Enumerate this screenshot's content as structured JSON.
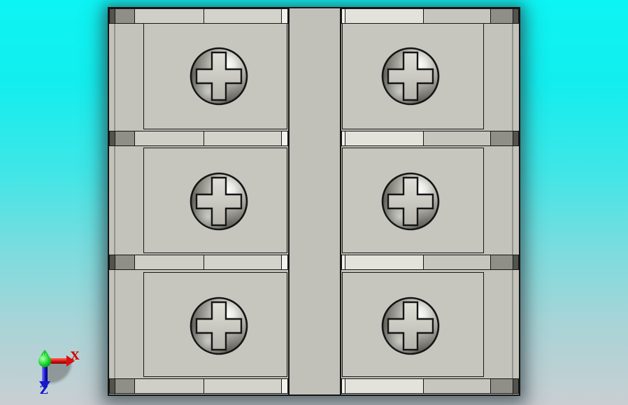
{
  "viewport": {
    "description": "3D CAD preview viewport, front view of a 6-position terminal block",
    "background_top_color": "#0df4f4",
    "background_bottom_color": "#c9ced2"
  },
  "model": {
    "kind": "terminal-block",
    "rows": 3,
    "columns": 2,
    "screw_count": 6,
    "colors": {
      "body": "#c3c3bb",
      "plate": "#c6c6be",
      "rail_light": "#cfcfc7",
      "rail_bright": "#e3e3db",
      "chamfer_white": "#f3f3ed",
      "corner_block": "#8f8f87",
      "edge_dark": "#54544e",
      "outline": "#161616",
      "screw_highlight": "#ffffff",
      "screw_shadow": "#33332e"
    }
  },
  "triad": {
    "x_axis": {
      "label": "X",
      "color": "#d40000"
    },
    "z_axis": {
      "label": "Z",
      "color": "#1414cc"
    },
    "origin_color": "#22cc33"
  }
}
